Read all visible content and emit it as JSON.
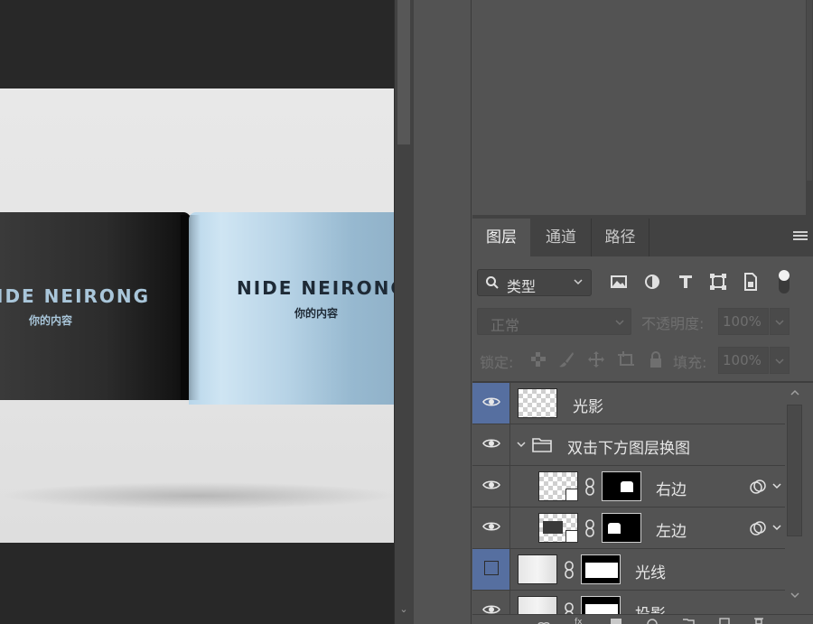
{
  "canvas": {
    "left_page_title": "IDE NEIRONG",
    "left_page_subtitle": "你的内容",
    "right_page_title": "NIDE NEIRONG",
    "right_page_subtitle": "你的内容"
  },
  "layers_panel": {
    "tabs": [
      {
        "label": "图层",
        "active": true
      },
      {
        "label": "通道",
        "active": false
      },
      {
        "label": "路径",
        "active": false
      }
    ],
    "filter": {
      "label": "类型"
    },
    "blend_mode": "正常",
    "opacity_label": "不透明度:",
    "opacity_value": "100%",
    "lock_label": "锁定:",
    "fill_label": "填充:",
    "fill_value": "100%",
    "layers": [
      {
        "name": "光影",
        "visible": true,
        "selected": true,
        "type": "pixel"
      },
      {
        "name": "双击下方图层换图",
        "visible": true,
        "selected": false,
        "type": "group"
      },
      {
        "name": "右边",
        "visible": true,
        "selected": false,
        "type": "smart-masked",
        "indent": true
      },
      {
        "name": "左边",
        "visible": true,
        "selected": false,
        "type": "smart-masked",
        "indent": true
      },
      {
        "name": "光线",
        "visible": false,
        "selected": true,
        "type": "masked"
      },
      {
        "name": "投影",
        "visible": true,
        "selected": false,
        "type": "masked"
      }
    ]
  },
  "colors": {
    "selection": "#566fa0",
    "panel_bg": "#535353",
    "canvas_bg": "#282828"
  }
}
